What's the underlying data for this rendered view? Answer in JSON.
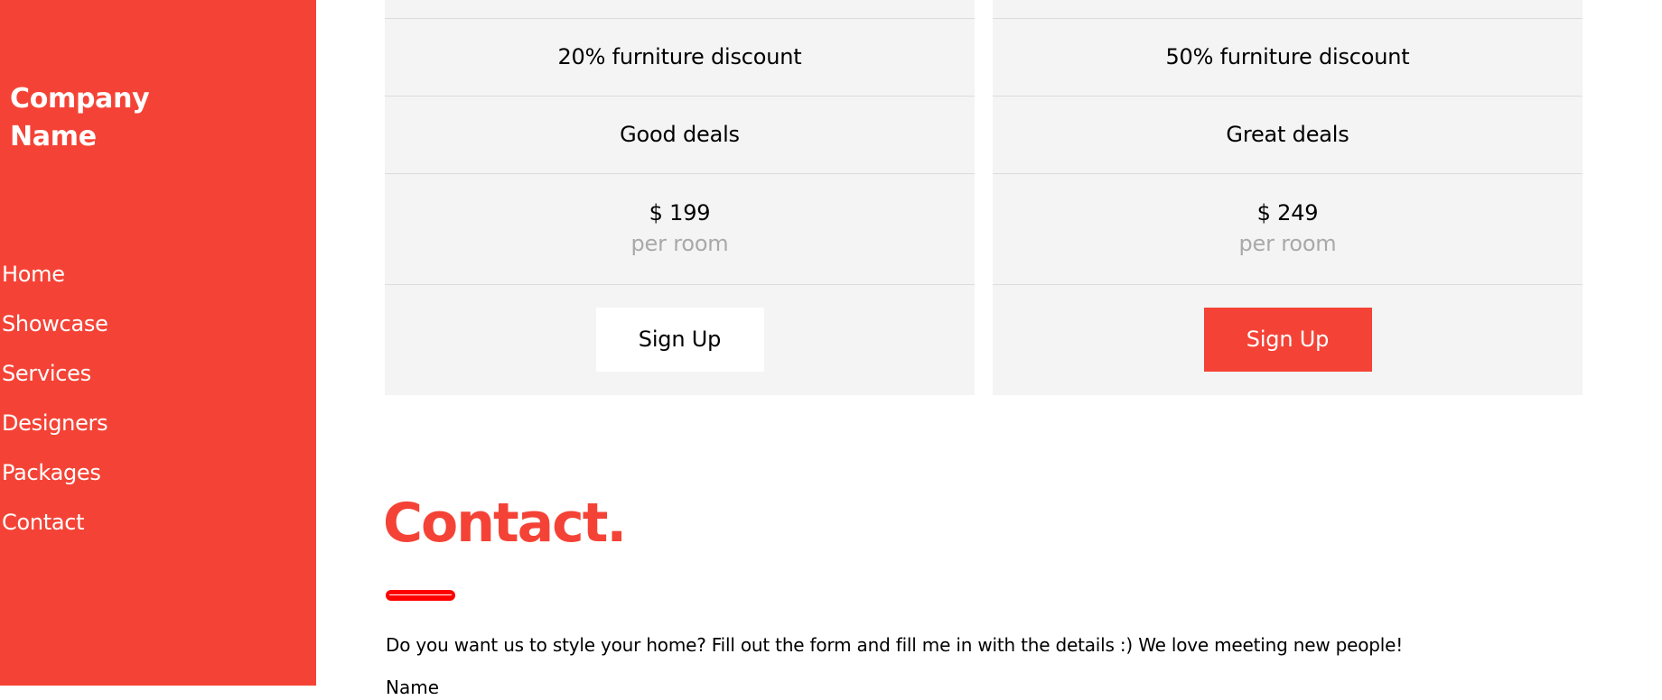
{
  "sidebar": {
    "brand": "Company Name",
    "nav": [
      "Home",
      "Showcase",
      "Services",
      "Designers",
      "Packages",
      "Contact"
    ]
  },
  "packages": [
    {
      "discount": "20% furniture discount",
      "deals": "Good deals",
      "price": "$ 199",
      "unit": "per room",
      "button": "Sign Up"
    },
    {
      "discount": "50% furniture discount",
      "deals": "Great deals",
      "price": "$ 249",
      "unit": "per room",
      "button": "Sign Up"
    }
  ],
  "contact": {
    "title": "Contact.",
    "intro": "Do you want us to style your home? Fill out the form and fill me in with the details :) We love meeting new people!",
    "name_label": "Name"
  },
  "colors": {
    "accent": "#f44336",
    "card_bg": "#f3f4f3",
    "muted": "#a9a9a9"
  }
}
